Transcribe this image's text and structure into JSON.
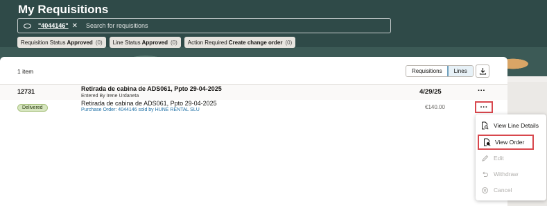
{
  "page": {
    "title": "My Requisitions"
  },
  "search": {
    "chip_value": "\"4044146\"",
    "chip_close": "✕",
    "placeholder": "Search for requisitions"
  },
  "filters": [
    {
      "label": "Requisition Status",
      "value": "Approved",
      "count": "(0)"
    },
    {
      "label": "Line Status",
      "value": "Approved",
      "count": "(0)"
    },
    {
      "label": "Action Required",
      "value": "Create change order",
      "count": "(0)"
    }
  ],
  "results": {
    "count_label": "1 item",
    "view_toggle": [
      "Requisitions",
      "Lines"
    ],
    "active_view": "Lines"
  },
  "requisition": {
    "id": "12731",
    "title": "Retirada de cabina de ADS061, Ppto 29-04-2025",
    "entered_by": "Entered By Irene Urdaneta",
    "date": "4/29/25",
    "menu_glyph": "···"
  },
  "line": {
    "status": "Delivered",
    "description": "Retirada de cabina de ADS061, Ppto 29-04-2025",
    "purchase_order": "Purchase Order: 4044146 sold by HUNE RENTAL SLU",
    "amount": "€140.00",
    "menu_glyph": "···"
  },
  "context_menu": [
    {
      "label": "View Line Details",
      "icon": "document-search-icon",
      "enabled": true
    },
    {
      "label": "View Order",
      "icon": "order-search-icon",
      "enabled": true,
      "highlighted": true
    },
    {
      "label": "Edit",
      "icon": "pencil-icon",
      "enabled": false
    },
    {
      "label": "Withdraw",
      "icon": "undo-icon",
      "enabled": false
    },
    {
      "label": "Cancel",
      "icon": "cancel-icon",
      "enabled": false
    }
  ],
  "colors": {
    "header_bg": "#2f4a48",
    "highlight_red": "#d8474d",
    "status_green": "#d7e6c0",
    "link_blue": "#1d6fa5"
  }
}
